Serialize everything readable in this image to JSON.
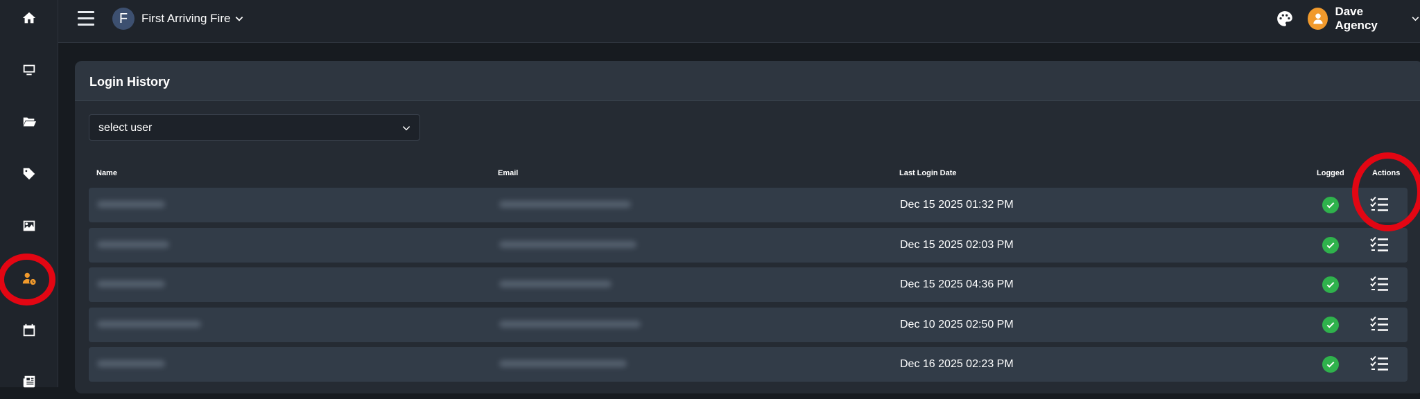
{
  "sidebar": {
    "items": [
      {
        "id": "home",
        "icon": "home-icon"
      },
      {
        "id": "monitor",
        "icon": "monitor-icon"
      },
      {
        "id": "folders",
        "icon": "folder-open-icon"
      },
      {
        "id": "tags",
        "icon": "tag-icon"
      },
      {
        "id": "images",
        "icon": "image-icon"
      },
      {
        "id": "user-history",
        "icon": "user-clock-icon",
        "active": true
      },
      {
        "id": "calendar",
        "icon": "calendar-icon"
      },
      {
        "id": "news",
        "icon": "newspaper-icon"
      }
    ],
    "active_color": "#f19a2c"
  },
  "topbar": {
    "org_initial": "F",
    "org_name": "First Arriving Fire",
    "user_name": "Dave Agency"
  },
  "card": {
    "title": "Login History",
    "select_placeholder": "select user"
  },
  "table": {
    "headers": {
      "name": "Name",
      "email": "Email",
      "last_login": "Last Login Date",
      "logged": "Logged",
      "actions": "Actions"
    },
    "rows": [
      {
        "last_login": "Dec 15 2025 01:32 PM",
        "logged": true
      },
      {
        "last_login": "Dec 15 2025 02:03 PM",
        "logged": true
      },
      {
        "last_login": "Dec 15 2025 04:36 PM",
        "logged": true
      },
      {
        "last_login": "Dec 10 2025 02:50 PM",
        "logged": true
      },
      {
        "last_login": "Dec 16 2025 02:23 PM",
        "logged": true
      }
    ]
  },
  "colors": {
    "annotation_ring": "#e30613",
    "logged_check": "#2fb24c",
    "accent": "#f19a2c"
  }
}
